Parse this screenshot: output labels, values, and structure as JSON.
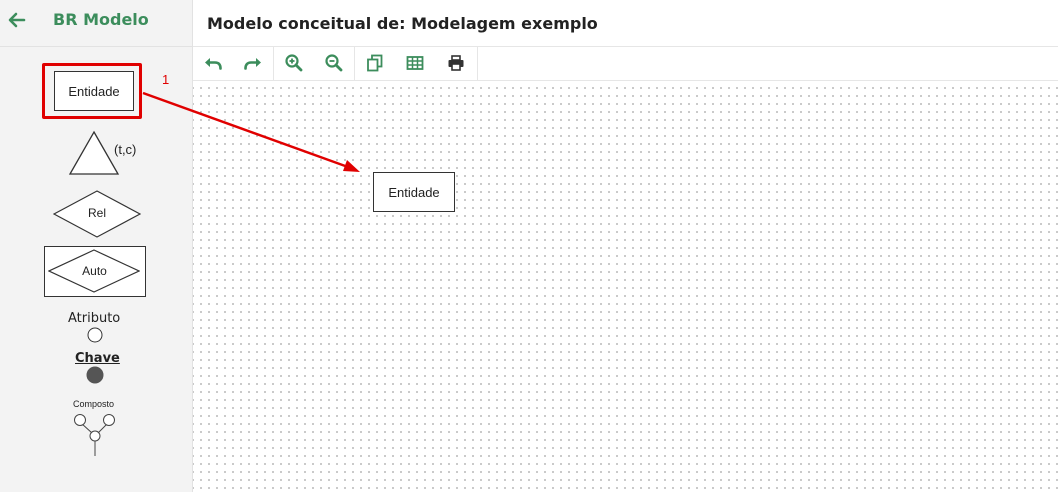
{
  "app": {
    "name": "BR Modelo",
    "back_icon": "arrow-left-icon",
    "accent": "#3c8d5c"
  },
  "header": {
    "title": "Modelo conceitual de: Modelagem exemplo"
  },
  "toolbar": {
    "buttons": [
      {
        "name": "undo",
        "icon": "undo-icon"
      },
      {
        "name": "redo",
        "icon": "redo-icon"
      },
      {
        "name": "zoom-in",
        "icon": "zoom-in-icon"
      },
      {
        "name": "zoom-out",
        "icon": "zoom-out-icon"
      },
      {
        "name": "duplicate",
        "icon": "copy-icon"
      },
      {
        "name": "table",
        "icon": "table-icon"
      },
      {
        "name": "print",
        "icon": "print-icon"
      }
    ]
  },
  "palette": {
    "entity": "Entidade",
    "specialization_label": "(t,c)",
    "relationship": "Rel",
    "associative_entity": "Auto",
    "attribute": "Atributo",
    "key_attribute": "Chave",
    "composite_attribute": "Composto",
    "step_number": "1",
    "highlight_color": "#e00000"
  },
  "canvas": {
    "entity_label": "Entidade"
  }
}
